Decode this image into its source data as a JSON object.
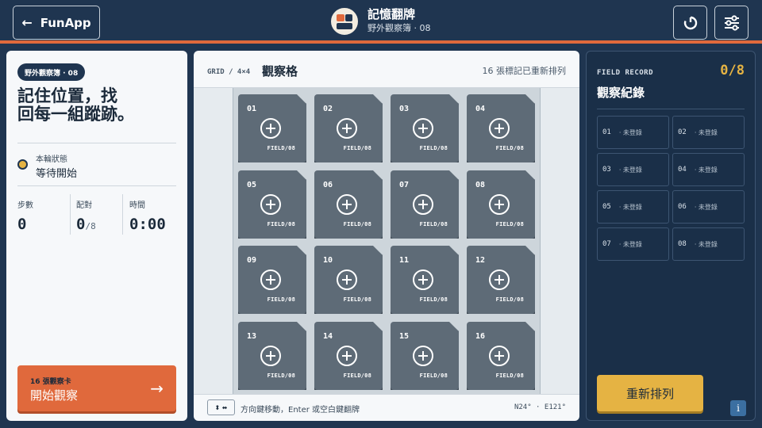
{
  "topbar": {
    "back_label": "FunApp",
    "title": "記憶翻牌",
    "subtitle": "野外觀察簿 · 08"
  },
  "left": {
    "badge": "野外觀察簿 · 08",
    "headline_line1": "記住位置，找",
    "headline_line2": "回每一組蹤跡。",
    "status_label": "本輪狀態",
    "status_value": "等待開始",
    "stats": {
      "steps_label": "步數",
      "steps_value": "0",
      "pairs_label": "配對",
      "pairs_value": "0",
      "pairs_total": "/8",
      "time_label": "時間",
      "time_value": "0:00"
    },
    "start": {
      "count_label": "16 張觀察卡",
      "label": "開始觀察",
      "arrow": "→"
    }
  },
  "center": {
    "grid_tag": "GRID / 4×4",
    "title": "觀察格",
    "note": "16 張標記已重新排列",
    "cards": [
      {
        "num": "01",
        "foot": "FIELD/08"
      },
      {
        "num": "02",
        "foot": "FIELD/08"
      },
      {
        "num": "03",
        "foot": "FIELD/08"
      },
      {
        "num": "04",
        "foot": "FIELD/08"
      },
      {
        "num": "05",
        "foot": "FIELD/08"
      },
      {
        "num": "06",
        "foot": "FIELD/08"
      },
      {
        "num": "07",
        "foot": "FIELD/08"
      },
      {
        "num": "08",
        "foot": "FIELD/08"
      },
      {
        "num": "09",
        "foot": "FIELD/08"
      },
      {
        "num": "10",
        "foot": "FIELD/08"
      },
      {
        "num": "11",
        "foot": "FIELD/08"
      },
      {
        "num": "12",
        "foot": "FIELD/08"
      },
      {
        "num": "13",
        "foot": "FIELD/08"
      },
      {
        "num": "14",
        "foot": "FIELD/08"
      },
      {
        "num": "15",
        "foot": "FIELD/08"
      },
      {
        "num": "16",
        "foot": "FIELD/08"
      }
    ],
    "key_hint_glyph": "⬍ ⬌",
    "hint": "方向鍵移動，Enter 或空白鍵翻牌",
    "coords": "N24° · E121°"
  },
  "right": {
    "tag": "FIELD RECORD",
    "score": "0/8",
    "title": "觀察紀錄",
    "slots": [
      {
        "num": "01",
        "status": "· 未登錄"
      },
      {
        "num": "02",
        "status": "· 未登錄"
      },
      {
        "num": "03",
        "status": "· 未登錄"
      },
      {
        "num": "04",
        "status": "· 未登錄"
      },
      {
        "num": "05",
        "status": "· 未登錄"
      },
      {
        "num": "06",
        "status": "· 未登錄"
      },
      {
        "num": "07",
        "status": "· 未登錄"
      },
      {
        "num": "08",
        "status": "· 未登錄"
      }
    ],
    "reshuffle_label": "重新排列",
    "info_glyph": "i"
  },
  "colors": {
    "navy": "#1f3550",
    "accent_orange": "#e0693c",
    "accent_gold": "#e5b343",
    "card": "#5e6b77"
  }
}
